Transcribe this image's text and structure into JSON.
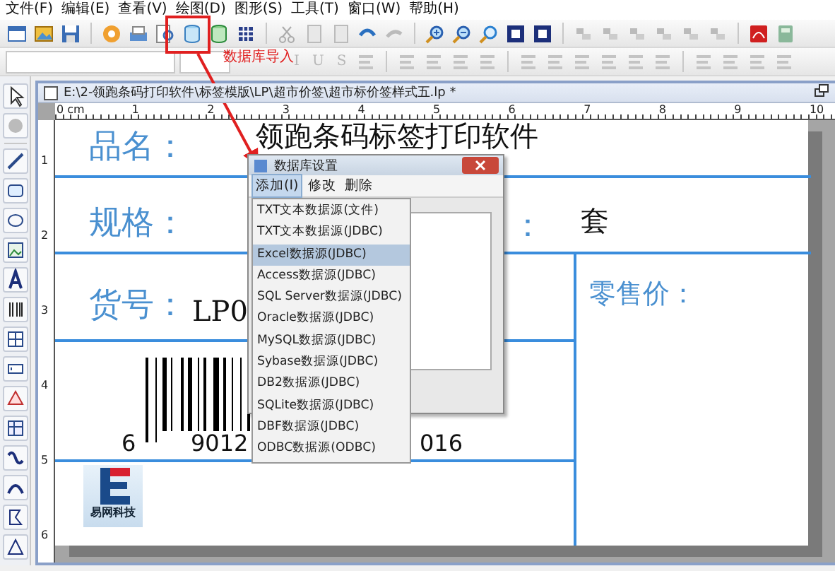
{
  "menu_bar": [
    "文件(F)",
    "编辑(E)",
    "查看(V)",
    "绘图(D)",
    "图形(S)",
    "工具(T)",
    "窗口(W)",
    "帮助(H)"
  ],
  "format_toolbar": {
    "buttons": [
      {
        "label": "I",
        "disabled": true
      },
      {
        "label": "U",
        "disabled": true
      },
      {
        "label": "S",
        "disabled": true
      }
    ]
  },
  "annotation": {
    "text": "数据库导入"
  },
  "document": {
    "title": "E:\\2-领跑条码打印软件\\标签模版\\LP\\超市价签\\超市标价签样式五.lp *",
    "top_ruler": [
      "0 cm",
      "1",
      "2",
      "3",
      "4",
      "5",
      "6",
      "7",
      "8",
      "9",
      "10"
    ],
    "left_ruler": [
      "1",
      "2",
      "3",
      "4",
      "5",
      "6"
    ]
  },
  "label": {
    "texts": [
      {
        "kind": "caption",
        "text": "品名："
      },
      {
        "kind": "value",
        "text": "领跑条码标签打印软件"
      },
      {
        "kind": "caption",
        "text": "规格："
      },
      {
        "kind": "caption",
        "text": "："
      },
      {
        "kind": "value",
        "text": "套"
      },
      {
        "kind": "caption",
        "text": "货号："
      },
      {
        "kind": "value",
        "text": "LP0"
      },
      {
        "kind": "caption",
        "text": "零售价："
      }
    ],
    "barcode_digits": [
      "6",
      "9012",
      "016"
    ],
    "logo_text": "易网科技"
  },
  "dialog": {
    "title": "数据库设置",
    "menus": [
      {
        "label": "添加(I)",
        "selected": true
      },
      {
        "label": "修改",
        "selected": false
      },
      {
        "label": "删除",
        "selected": false
      }
    ]
  },
  "dropdown": {
    "items": [
      {
        "label": "TXT文本数据源(文件)",
        "selected": false
      },
      {
        "label": "TXT文本数据源(JDBC)",
        "selected": false
      },
      {
        "label": "Excel数据源(JDBC)",
        "selected": true
      },
      {
        "label": "Access数据源(JDBC)",
        "selected": false
      },
      {
        "label": "SQL Server数据源(JDBC)",
        "selected": false
      },
      {
        "label": "Oracle数据源(JDBC)",
        "selected": false
      },
      {
        "label": "MySQL数据源(JDBC)",
        "selected": false
      },
      {
        "label": "Sybase数据源(JDBC)",
        "selected": false
      },
      {
        "label": "DB2数据源(JDBC)",
        "selected": false
      },
      {
        "label": "SQLite数据源(JDBC)",
        "selected": false
      },
      {
        "label": "DBF数据源(JDBC)",
        "selected": false
      },
      {
        "label": "ODBC数据源(ODBC)",
        "selected": false
      }
    ]
  }
}
